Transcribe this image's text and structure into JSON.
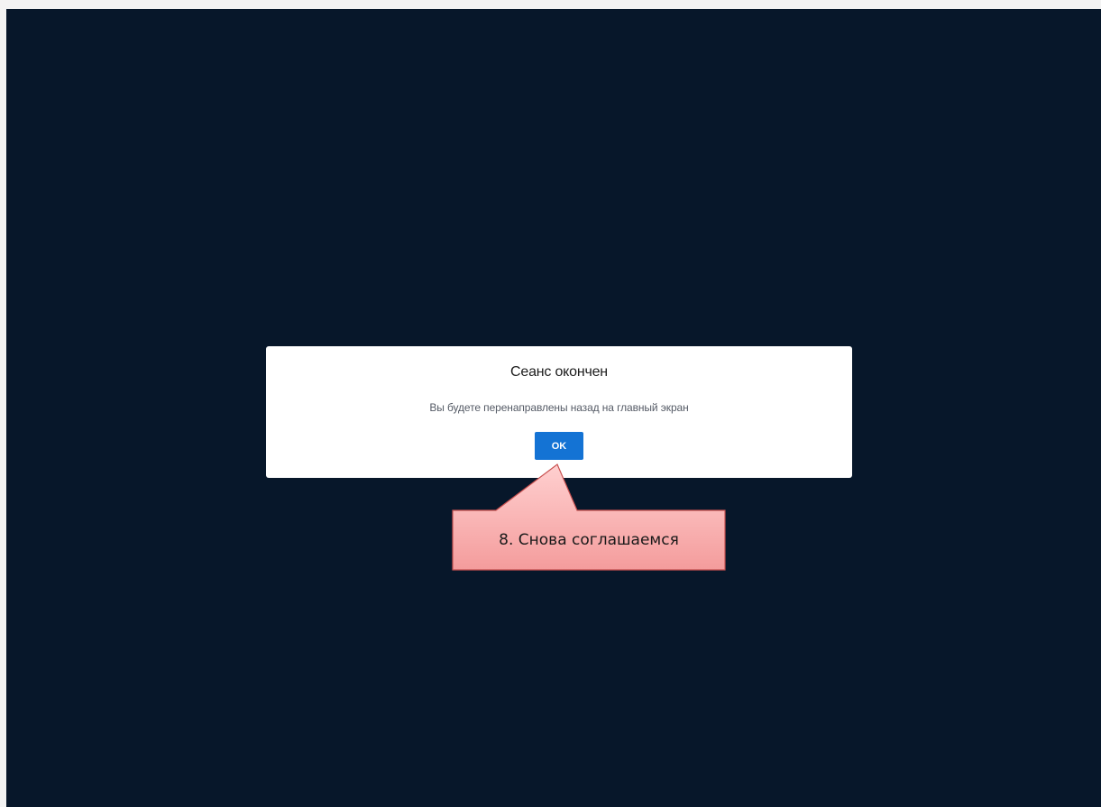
{
  "dialog": {
    "title": "Сеанс окончен",
    "message": "Вы будете перенаправлены назад на главный экран",
    "ok_label": "OK"
  },
  "annotation": {
    "text": "8. Снова соглашаемся",
    "fill_color": "#f9b3b3",
    "border_color": "#c8504f"
  },
  "colors": {
    "background": "#07172a",
    "button": "#1473d4"
  }
}
